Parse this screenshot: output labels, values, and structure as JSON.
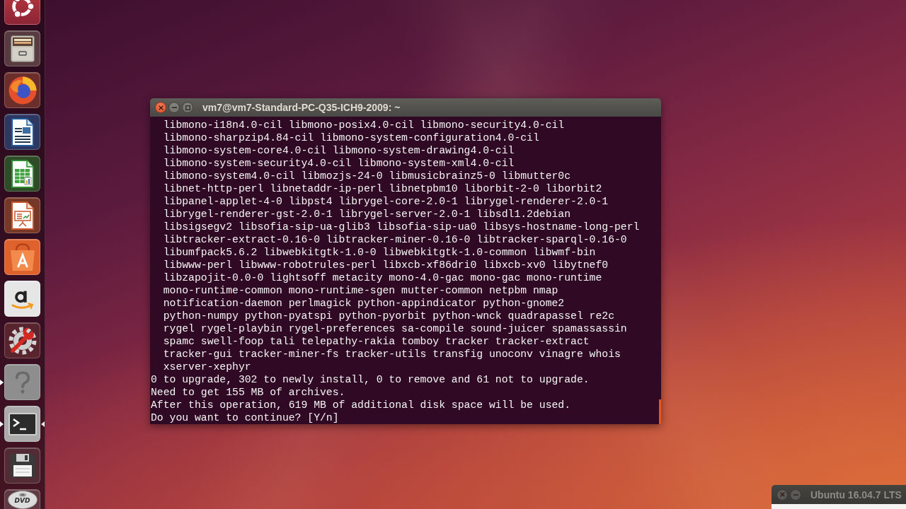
{
  "launcher": {
    "items": [
      {
        "kind": "dash",
        "running": false,
        "focused": false
      },
      {
        "kind": "files",
        "running": false,
        "focused": false
      },
      {
        "kind": "browser",
        "running": false,
        "focused": false
      },
      {
        "kind": "writer",
        "running": false,
        "focused": false
      },
      {
        "kind": "calc",
        "running": false,
        "focused": false
      },
      {
        "kind": "impress",
        "running": false,
        "focused": false
      },
      {
        "kind": "software",
        "running": false,
        "focused": false
      },
      {
        "kind": "amazon",
        "running": false,
        "focused": false
      },
      {
        "kind": "settings",
        "running": false,
        "focused": false
      },
      {
        "kind": "help",
        "running": true,
        "focused": false
      },
      {
        "kind": "terminal",
        "running": true,
        "focused": true
      },
      {
        "kind": "floppy",
        "running": false,
        "focused": false
      },
      {
        "kind": "dvd",
        "label": "DVD",
        "running": false,
        "focused": false
      }
    ]
  },
  "terminal_window": {
    "title": "vm7@vm7-Standard-PC-Q35-ICH9-2009: ~",
    "active": true,
    "controls": [
      {
        "kind": "close"
      },
      {
        "kind": "minimize"
      },
      {
        "kind": "maximize"
      }
    ],
    "lines": [
      "  libmono-i18n4.0-cil libmono-posix4.0-cil libmono-security4.0-cil",
      "  libmono-sharpzip4.84-cil libmono-system-configuration4.0-cil",
      "  libmono-system-core4.0-cil libmono-system-drawing4.0-cil",
      "  libmono-system-security4.0-cil libmono-system-xml4.0-cil",
      "  libmono-system4.0-cil libmozjs-24-0 libmusicbrainz5-0 libmutter0c",
      "  libnet-http-perl libnetaddr-ip-perl libnetpbm10 liborbit-2-0 liborbit2",
      "  libpanel-applet-4-0 libpst4 librygel-core-2.0-1 librygel-renderer-2.0-1",
      "  librygel-renderer-gst-2.0-1 librygel-server-2.0-1 libsdl1.2debian",
      "  libsigsegv2 libsofia-sip-ua-glib3 libsofia-sip-ua0 libsys-hostname-long-perl",
      "  libtracker-extract-0.16-0 libtracker-miner-0.16-0 libtracker-sparql-0.16-0",
      "  libumfpack5.6.2 libwebkitgtk-1.0-0 libwebkitgtk-1.0-common libwmf-bin",
      "  libwww-perl libwww-robotrules-perl libxcb-xf86dri0 libxcb-xv0 libytnef0",
      "  libzapojit-0.0-0 lightsoff metacity mono-4.0-gac mono-gac mono-runtime",
      "  mono-runtime-common mono-runtime-sgen mutter-common netpbm nmap",
      "  notification-daemon perlmagick python-appindicator python-gnome2",
      "  python-numpy python-pyatspi python-pyorbit python-wnck quadrapassel re2c",
      "  rygel rygel-playbin rygel-preferences sa-compile sound-juicer spamassassin",
      "  spamc swell-foop tali telepathy-rakia tomboy tracker tracker-extract",
      "  tracker-gui tracker-miner-fs tracker-utils transfig unoconv vinagre whois",
      "  xserver-xephyr",
      "0 to upgrade, 302 to newly install, 0 to remove and 61 not to upgrade.",
      "Need to get 155 MB of archives.",
      "After this operation, 619 MB of additional disk space will be used.",
      "Do you want to continue? [Y/n]"
    ]
  },
  "other_window": {
    "title": "Ubuntu 16.04.7 LTS",
    "active": false,
    "controls": [
      {
        "kind": "close"
      },
      {
        "kind": "minimize"
      }
    ]
  }
}
